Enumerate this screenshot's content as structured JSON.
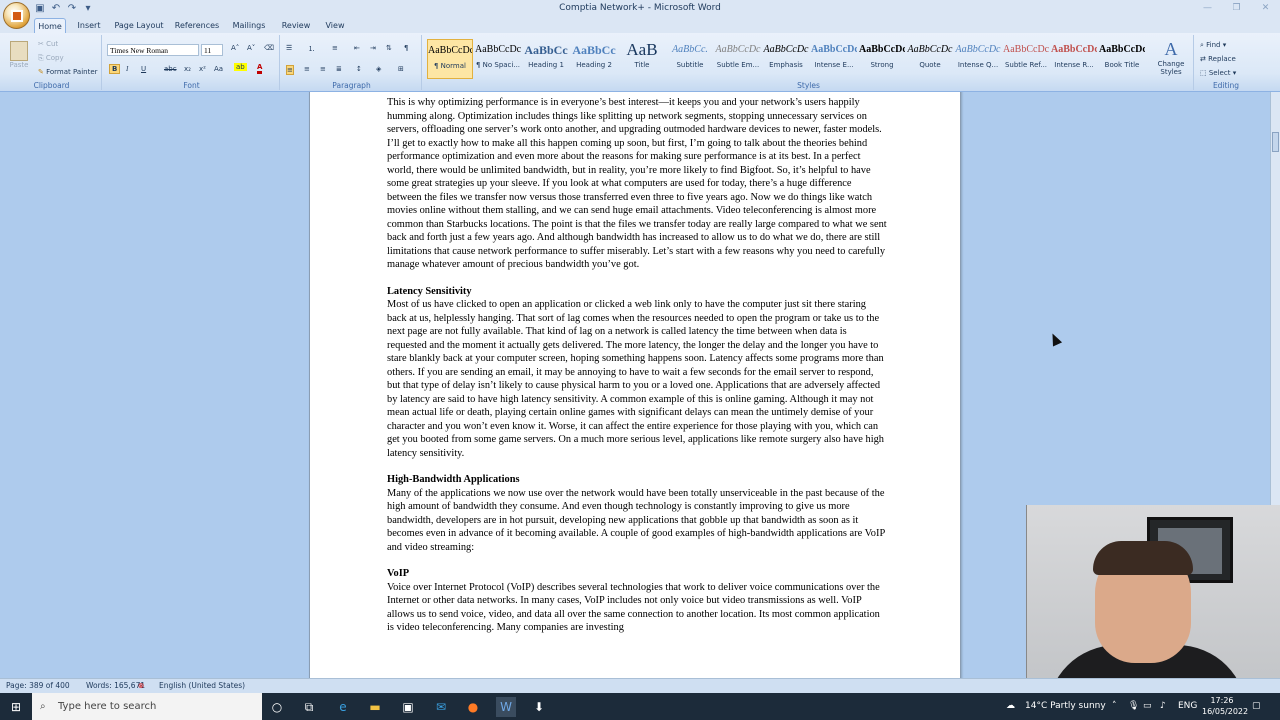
{
  "window": {
    "title": "Comptia Network+ - Microsoft Word"
  },
  "tabs": [
    "Home",
    "Insert",
    "Page Layout",
    "References",
    "Mailings",
    "Review",
    "View"
  ],
  "clipboard": {
    "paste": "Paste",
    "cut": "Cut",
    "copy": "Copy",
    "format_painter": "Format Painter",
    "label": "Clipboard"
  },
  "font": {
    "family": "Times New Roman",
    "size": "11",
    "label": "Font"
  },
  "paragraph": {
    "label": "Paragraph"
  },
  "styles": {
    "label": "Styles",
    "items": [
      {
        "preview": "AaBbCcDc",
        "name": "¶ Normal"
      },
      {
        "preview": "AaBbCcDc",
        "name": "¶ No Spaci..."
      },
      {
        "preview": "AaBbCc",
        "name": "Heading 1"
      },
      {
        "preview": "AaBbCc",
        "name": "Heading 2"
      },
      {
        "preview": "AaB",
        "name": "Title"
      },
      {
        "preview": "AaBbCc.",
        "name": "Subtitle"
      },
      {
        "preview": "AaBbCcDc",
        "name": "Subtle Em..."
      },
      {
        "preview": "AaBbCcDc",
        "name": "Emphasis"
      },
      {
        "preview": "AaBbCcDc",
        "name": "Intense E..."
      },
      {
        "preview": "AaBbCcDc",
        "name": "Strong"
      },
      {
        "preview": "AaBbCcDc",
        "name": "Quote"
      },
      {
        "preview": "AaBbCcDc",
        "name": "Intense Q..."
      },
      {
        "preview": "AaBbCcDc",
        "name": "Subtle Ref..."
      },
      {
        "preview": "AaBbCcDc",
        "name": "Intense R..."
      },
      {
        "preview": "AaBbCcDc",
        "name": "Book Title"
      }
    ],
    "change_styles": "Change Styles"
  },
  "editing": {
    "label": "Editing",
    "find": "Find",
    "replace": "Replace",
    "select": "Select"
  },
  "document": {
    "para1": "This is why optimizing performance is in everyone’s best interest—it keeps you and your network’s users happily humming along. Optimization includes things like splitting up network segments, stopping unnecessary services on servers, offloading one server’s work onto another, and upgrading outmoded hardware devices to newer, faster models. I’ll get to exactly how to make all this happen coming up soon, but first, I’m going to talk about the theories behind performance optimization and even more about the reasons for making sure performance is at its best. In a perfect world, there would be unlimited bandwidth, but in reality, you’re more likely to find Bigfoot. So, it’s helpful to have some great strategies up your sleeve. If you look at what computers are used for today, there’s a huge difference between the files we transfer now versus those transferred even three to five years ago. Now we do things like watch movies online without them stalling, and we can send huge email attachments. Video teleconferencing is almost more common than Starbucks locations. The point is that the files we transfer today are really large compared to what we sent back and forth just a few years ago. And although bandwidth has increased to allow us to do what we do, there are still limitations that cause network performance to suffer miserably. Let’s start with a few reasons why you need to carefully manage whatever amount of precious bandwidth you’ve got.",
    "heading_latency": "Latency Sensitivity",
    "para_latency": "Most of us have clicked to open an application or clicked a web link only to have the computer just sit there staring back at us, helplessly hanging. That sort of lag comes when the resources needed to open the program or take us to the next page are not fully available. That kind of lag on a network is called latency the time between when data is requested and the moment it actually gets delivered. The more latency, the longer the delay and the longer you have to stare blankly back at your computer screen, hoping something happens soon. Latency affects some programs more than others. If you are sending an email, it may be annoying to have to wait a few seconds for the email server to respond, but that type of delay isn’t likely to cause physical harm to you or a loved one. Applications that are adversely affected by latency are said to have high latency sensitivity. A common example of this is online gaming. Although it may not mean actual life or death, playing certain online games with significant delays can mean the untimely demise of your character and you won’t even know it. Worse, it can affect the entire experience for those playing with you, which can get you booted from some game servers. On a much more serious level, applications like remote surgery also have high latency sensitivity.",
    "heading_bandwidth": "High-Bandwidth Applications",
    "para_bandwidth": "Many of the applications we now use over the network would have been totally unserviceable in the past because of the high amount of bandwidth they consume. And even though technology is constantly improving to give us more bandwidth, developers are in hot pursuit, developing new applications that gobble up that bandwidth as soon as it becomes even in advance of it becoming available. A couple of good examples of high-bandwidth applications are VoIP and video streaming:",
    "heading_voip": "VoIP",
    "para_voip": "Voice over Internet Protocol (VoIP) describes several technologies that work to deliver voice communications over the Internet or other data networks. In many cases, VoIP includes not only voice but video transmissions as well. VoIP allows us to send voice, video, and data all over the same connection to another location. Its most common application is video teleconferencing. Many companies are investing"
  },
  "status": {
    "page": "Page: 389 of 400",
    "words": "Words: 165,671",
    "language": "English (United States)"
  },
  "taskbar": {
    "search_placeholder": "Type here to search",
    "weather": "14°C  Partly sunny",
    "lang": "ENG",
    "time": "17:26",
    "date": "16/05/2022"
  }
}
